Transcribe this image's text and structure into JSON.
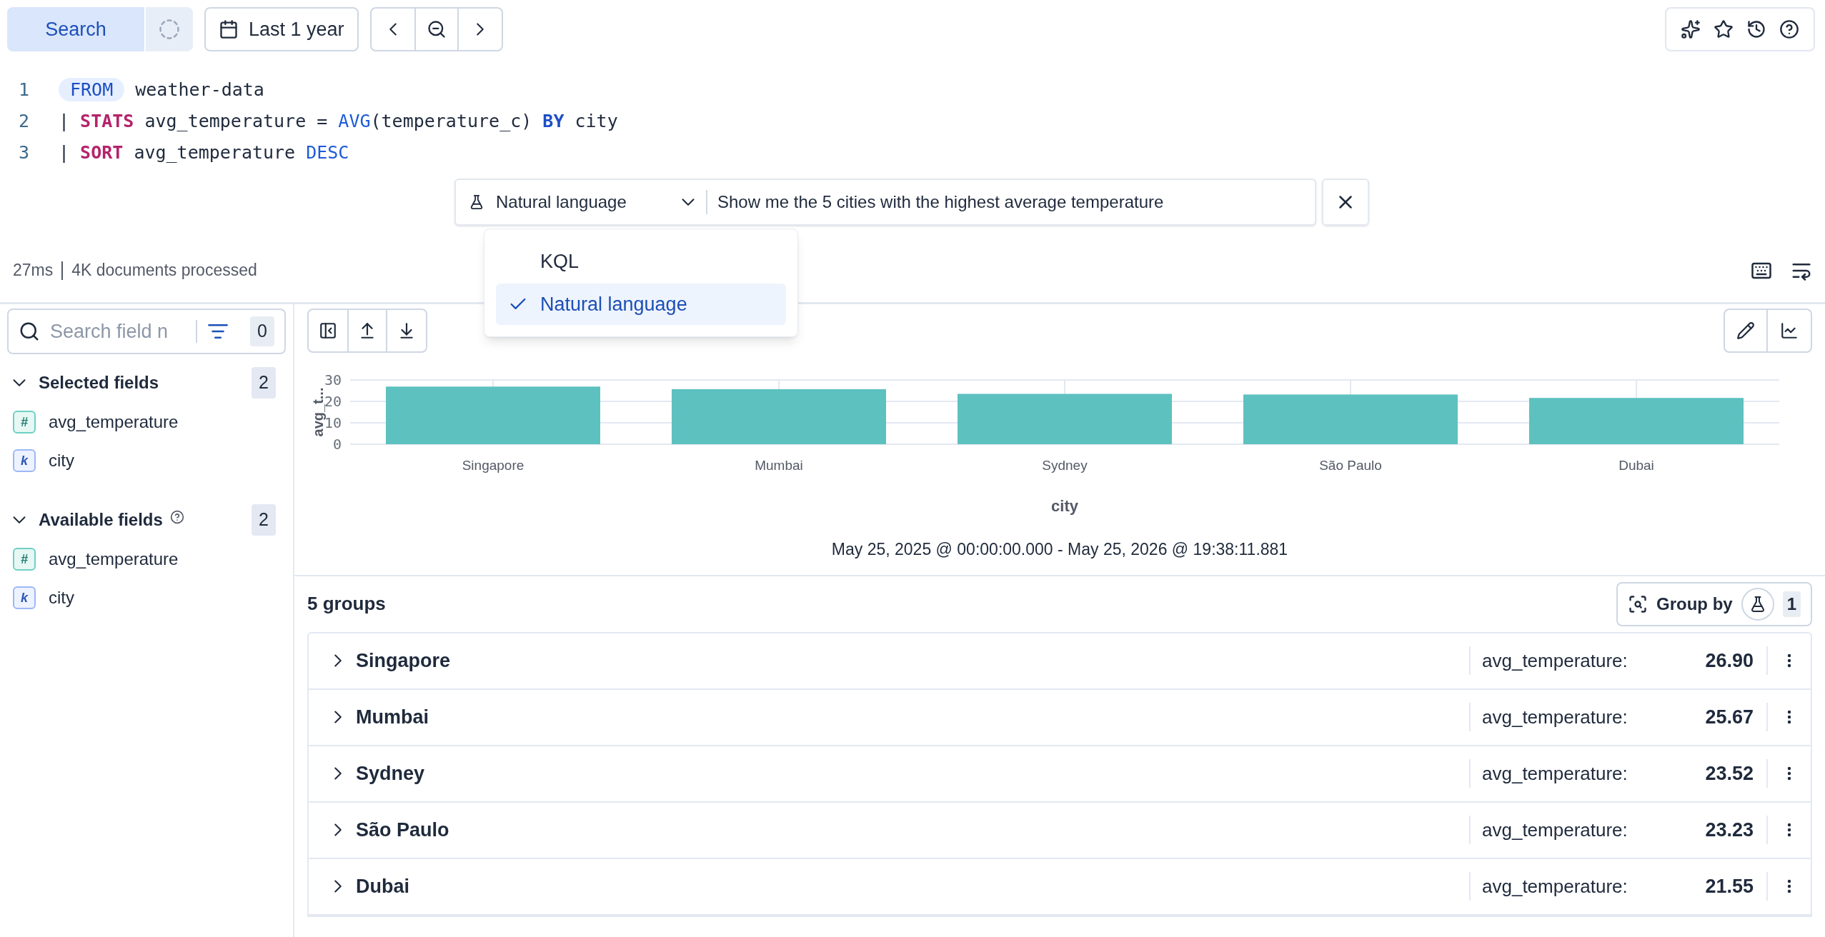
{
  "toolbar": {
    "search_button": "Search",
    "date_picker": "Last 1 year"
  },
  "editor": {
    "lines": [
      {
        "number": "1",
        "tokens": [
          {
            "kind": "source_command",
            "text": "FROM"
          },
          {
            "kind": "plain",
            "text": " weather-data"
          }
        ]
      },
      {
        "number": "2",
        "tokens": [
          {
            "kind": "plain",
            "text": "| "
          },
          {
            "kind": "command",
            "text": "STATS"
          },
          {
            "kind": "plain",
            "text": " avg_temperature = "
          },
          {
            "kind": "function",
            "text": "AVG"
          },
          {
            "kind": "plain",
            "text": "(temperature_c) "
          },
          {
            "kind": "operator",
            "text": "BY"
          },
          {
            "kind": "plain",
            "text": " city"
          }
        ]
      },
      {
        "number": "3",
        "tokens": [
          {
            "kind": "plain",
            "text": "| "
          },
          {
            "kind": "command",
            "text": "SORT"
          },
          {
            "kind": "plain",
            "text": " avg_temperature "
          },
          {
            "kind": "keyword",
            "text": "DESC"
          }
        ]
      }
    ]
  },
  "query_assistant": {
    "mode": "Natural language",
    "prompt": "Show me the 5 cities with the highest average temperature",
    "menu": [
      {
        "label": "KQL",
        "selected": false
      },
      {
        "label": "Natural language",
        "selected": true
      }
    ]
  },
  "status": {
    "timing": "27ms",
    "documents": "4K documents processed"
  },
  "sidebar": {
    "search_placeholder": "Search field n",
    "filter_count": "0",
    "sections": [
      {
        "title": "Selected fields",
        "count": "2",
        "expanded": true,
        "help": false,
        "fields": [
          {
            "name": "avg_temperature",
            "badge": "#",
            "kind": "number"
          },
          {
            "name": "city",
            "badge": "k",
            "kind": "keyword"
          }
        ]
      },
      {
        "title": "Available fields",
        "count": "2",
        "expanded": true,
        "help": true,
        "fields": [
          {
            "name": "avg_temperature",
            "badge": "#",
            "kind": "number"
          },
          {
            "name": "city",
            "badge": "k",
            "kind": "keyword"
          }
        ]
      }
    ]
  },
  "chart": {
    "chart_data": {
      "type": "bar",
      "xlabel": "city",
      "ylabel": "avg_t...",
      "categories": [
        "Singapore",
        "Mumbai",
        "Sydney",
        "São Paulo",
        "Dubai"
      ],
      "series": [
        {
          "color": "#5dc1bf",
          "values": [
            26.9,
            25.7,
            23.5,
            23.2,
            21.6
          ]
        }
      ],
      "ylim": [
        0,
        30
      ],
      "yticks": [
        0,
        10,
        20,
        30
      ],
      "grid": true
    },
    "time_range": "May 25, 2025 @ 00:00:00.000 - May 25, 2026 @ 19:38:11.881"
  },
  "groups": {
    "title": "5 groups",
    "group_by": {
      "label": "Group by",
      "count": "1"
    },
    "rows": [
      {
        "name": "Singapore",
        "metric": "avg_temperature:",
        "value": "26.90",
        "expanded": false
      },
      {
        "name": "Mumbai",
        "metric": "avg_temperature:",
        "value": "25.67",
        "expanded": false
      },
      {
        "name": "Sydney",
        "metric": "avg_temperature:",
        "value": "23.52",
        "expanded": false
      },
      {
        "name": "São Paulo",
        "metric": "avg_temperature:",
        "value": "23.23",
        "expanded": false
      },
      {
        "name": "Dubai",
        "metric": "avg_temperature:",
        "value": "21.55",
        "expanded": false
      }
    ]
  }
}
